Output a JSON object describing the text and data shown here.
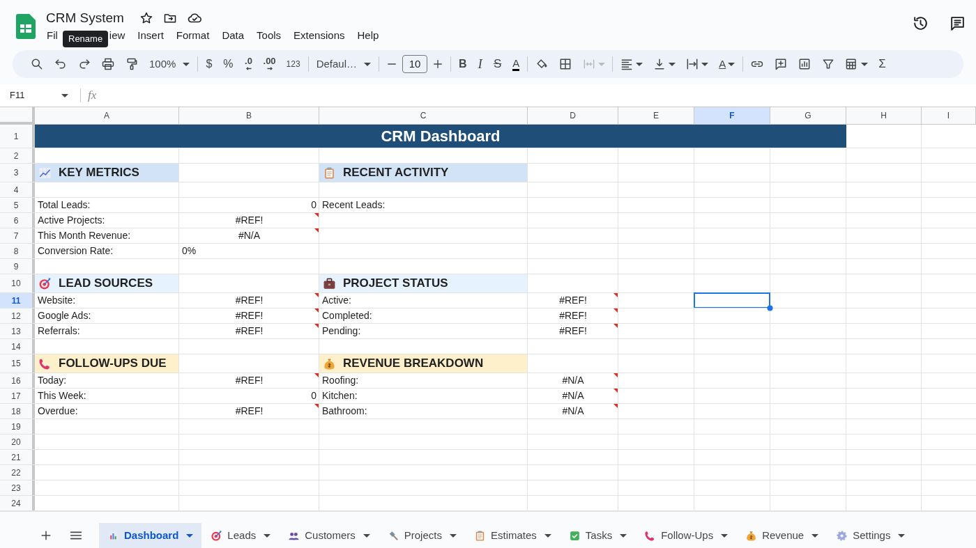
{
  "document": {
    "title": "CRM System"
  },
  "menu": [
    "Fil",
    "iew",
    "Insert",
    "Format",
    "Data",
    "Tools",
    "Extensions",
    "Help"
  ],
  "tooltip": "Rename",
  "toolbar": [
    {
      "kind": "icon"
    },
    {
      "kind": "icon"
    },
    {
      "kind": "icon"
    },
    {
      "kind": "icon"
    },
    {
      "kind": "icon"
    },
    {
      "kind": "dropdown",
      "text": "100%"
    },
    {
      "kind": "separator"
    },
    {
      "kind": "text",
      "text": "$"
    },
    {
      "kind": "text",
      "text": "%"
    },
    {
      "kind": "decimal",
      "text": ".0"
    },
    {
      "kind": "decimal",
      "text": ".00"
    },
    {
      "kind": "text",
      "text": "123"
    },
    {
      "kind": "separator"
    },
    {
      "kind": "dropdown",
      "text": "Defaul…"
    },
    {
      "kind": "separator"
    },
    {
      "kind": "stepper",
      "text": "10"
    },
    {
      "kind": "separator"
    },
    {
      "kind": "text",
      "text": "B"
    },
    {
      "kind": "text",
      "text": "I"
    },
    {
      "kind": "text",
      "text": "S"
    },
    {
      "kind": "text",
      "text": "A"
    },
    {
      "kind": "separator"
    },
    {
      "kind": "icon"
    },
    {
      "kind": "icon"
    },
    {
      "kind": "icon",
      "disabled": true,
      "caret": true
    },
    {
      "kind": "separator"
    },
    {
      "kind": "icon",
      "caret": true
    },
    {
      "kind": "icon",
      "caret": true
    },
    {
      "kind": "icon",
      "caret": true
    },
    {
      "kind": "text",
      "text": "A",
      "caret": true
    },
    {
      "kind": "separator"
    },
    {
      "kind": "icon"
    },
    {
      "kind": "icon"
    },
    {
      "kind": "icon"
    },
    {
      "kind": "icon"
    },
    {
      "kind": "icon",
      "caret": true
    },
    {
      "kind": "text",
      "text": "Σ"
    }
  ],
  "name_box": "F11",
  "formula_label": "fx",
  "sheet": {
    "columns": [
      {
        "label": "A",
        "selected": false
      },
      {
        "label": "B",
        "selected": false
      },
      {
        "label": "C",
        "selected": false
      },
      {
        "label": "D",
        "selected": false
      },
      {
        "label": "E",
        "selected": false
      },
      {
        "label": "F",
        "selected": true
      },
      {
        "label": "G",
        "selected": false
      },
      {
        "label": "H",
        "selected": false
      },
      {
        "label": "I",
        "selected": false
      }
    ],
    "rows": [
      {
        "label": "1",
        "selected": false,
        "cells": [
          {
            "kind": "title",
            "text": "CRM Dashboard"
          }
        ]
      },
      {
        "label": "2",
        "selected": false
      },
      {
        "label": "3",
        "selected": false,
        "cells": [
          {
            "kind": "section",
            "text": "KEY METRICS",
            "color": "#d3e3f7"
          },
          {},
          {
            "kind": "section",
            "text": "RECENT ACTIVITY",
            "color": "#d3e3f7"
          }
        ]
      },
      {
        "label": "4",
        "selected": false
      },
      {
        "label": "5",
        "selected": false,
        "cells": [
          {
            "kind": "label",
            "text": "Total Leads:"
          },
          {
            "kind": "number",
            "text": "0"
          },
          {
            "kind": "label",
            "text": "Recent Leads:"
          }
        ]
      },
      {
        "label": "6",
        "selected": false,
        "cells": [
          {
            "kind": "label",
            "text": "Active Projects:"
          },
          {
            "kind": "error",
            "text": "#REF!",
            "flag": true
          }
        ]
      },
      {
        "label": "7",
        "selected": false,
        "cells": [
          {
            "kind": "label",
            "text": "This Month Revenue:"
          },
          {
            "kind": "error",
            "text": "#N/A",
            "flag": true
          }
        ]
      },
      {
        "label": "8",
        "selected": false,
        "cells": [
          {
            "kind": "label",
            "text": "Conversion Rate:"
          },
          {
            "kind": "label",
            "text": "0%"
          }
        ]
      },
      {
        "label": "9",
        "selected": false
      },
      {
        "label": "10",
        "selected": false,
        "cells": [
          {
            "kind": "section",
            "text": "LEAD SOURCES",
            "color": "#e6f2fd"
          },
          {},
          {
            "kind": "section",
            "text": "PROJECT STATUS",
            "color": "#e6f2fd"
          }
        ]
      },
      {
        "label": "11",
        "selected": true,
        "cells": [
          {
            "kind": "label",
            "text": "Website:"
          },
          {
            "kind": "error",
            "text": "#REF!",
            "flag": true
          },
          {
            "kind": "label",
            "text": "Active:"
          },
          {
            "kind": "error",
            "text": "#REF!",
            "flag": true
          }
        ]
      },
      {
        "label": "12",
        "selected": false,
        "cells": [
          {
            "kind": "label",
            "text": "Google Ads:"
          },
          {
            "kind": "error",
            "text": "#REF!",
            "flag": true
          },
          {
            "kind": "label",
            "text": "Completed:"
          },
          {
            "kind": "error",
            "text": "#REF!",
            "flag": true
          }
        ]
      },
      {
        "label": "13",
        "selected": false,
        "cells": [
          {
            "kind": "label",
            "text": "Referrals:"
          },
          {
            "kind": "error",
            "text": "#REF!",
            "flag": true
          },
          {
            "kind": "label",
            "text": "Pending:"
          },
          {
            "kind": "error",
            "text": "#REF!",
            "flag": true
          }
        ]
      },
      {
        "label": "14",
        "selected": false
      },
      {
        "label": "15",
        "selected": false,
        "cells": [
          {
            "kind": "section",
            "text": "FOLLOW-UPS DUE",
            "color": "#fff0cc"
          },
          {},
          {
            "kind": "section",
            "text": "REVENUE BREAKDOWN",
            "color": "#fff0cc"
          }
        ]
      },
      {
        "label": "16",
        "selected": false,
        "cells": [
          {
            "kind": "label",
            "text": "Today:"
          },
          {
            "kind": "error",
            "text": "#REF!",
            "flag": true
          },
          {
            "kind": "label",
            "text": "Roofing:"
          },
          {
            "kind": "error",
            "text": "#N/A",
            "flag": true
          }
        ]
      },
      {
        "label": "17",
        "selected": false,
        "cells": [
          {
            "kind": "label",
            "text": "This Week:"
          },
          {
            "kind": "number",
            "text": "0"
          },
          {
            "kind": "label",
            "text": "Kitchen:"
          },
          {
            "kind": "error",
            "text": "#N/A",
            "flag": true
          }
        ]
      },
      {
        "label": "18",
        "selected": false,
        "cells": [
          {
            "kind": "label",
            "text": "Overdue:"
          },
          {
            "kind": "error",
            "text": "#REF!",
            "flag": true
          },
          {
            "kind": "label",
            "text": "Bathroom:"
          },
          {
            "kind": "error",
            "text": "#N/A",
            "flag": true
          }
        ]
      },
      {
        "label": "19",
        "selected": false
      },
      {
        "label": "20",
        "selected": false
      },
      {
        "label": "21",
        "selected": false
      },
      {
        "label": "22",
        "selected": false
      },
      {
        "label": "23",
        "selected": false
      },
      {
        "label": "24",
        "selected": false
      }
    ]
  },
  "sheet_tabs": [
    {
      "label": "Dashboard",
      "selected": true
    },
    {
      "label": "Leads",
      "selected": false
    },
    {
      "label": "Customers",
      "selected": false
    },
    {
      "label": "Projects",
      "selected": false
    },
    {
      "label": "Estimates",
      "selected": false
    },
    {
      "label": "Tasks",
      "selected": false
    },
    {
      "label": "Follow-Ups",
      "selected": false
    },
    {
      "label": "Revenue",
      "selected": false
    },
    {
      "label": "Settings",
      "selected": false
    }
  ]
}
